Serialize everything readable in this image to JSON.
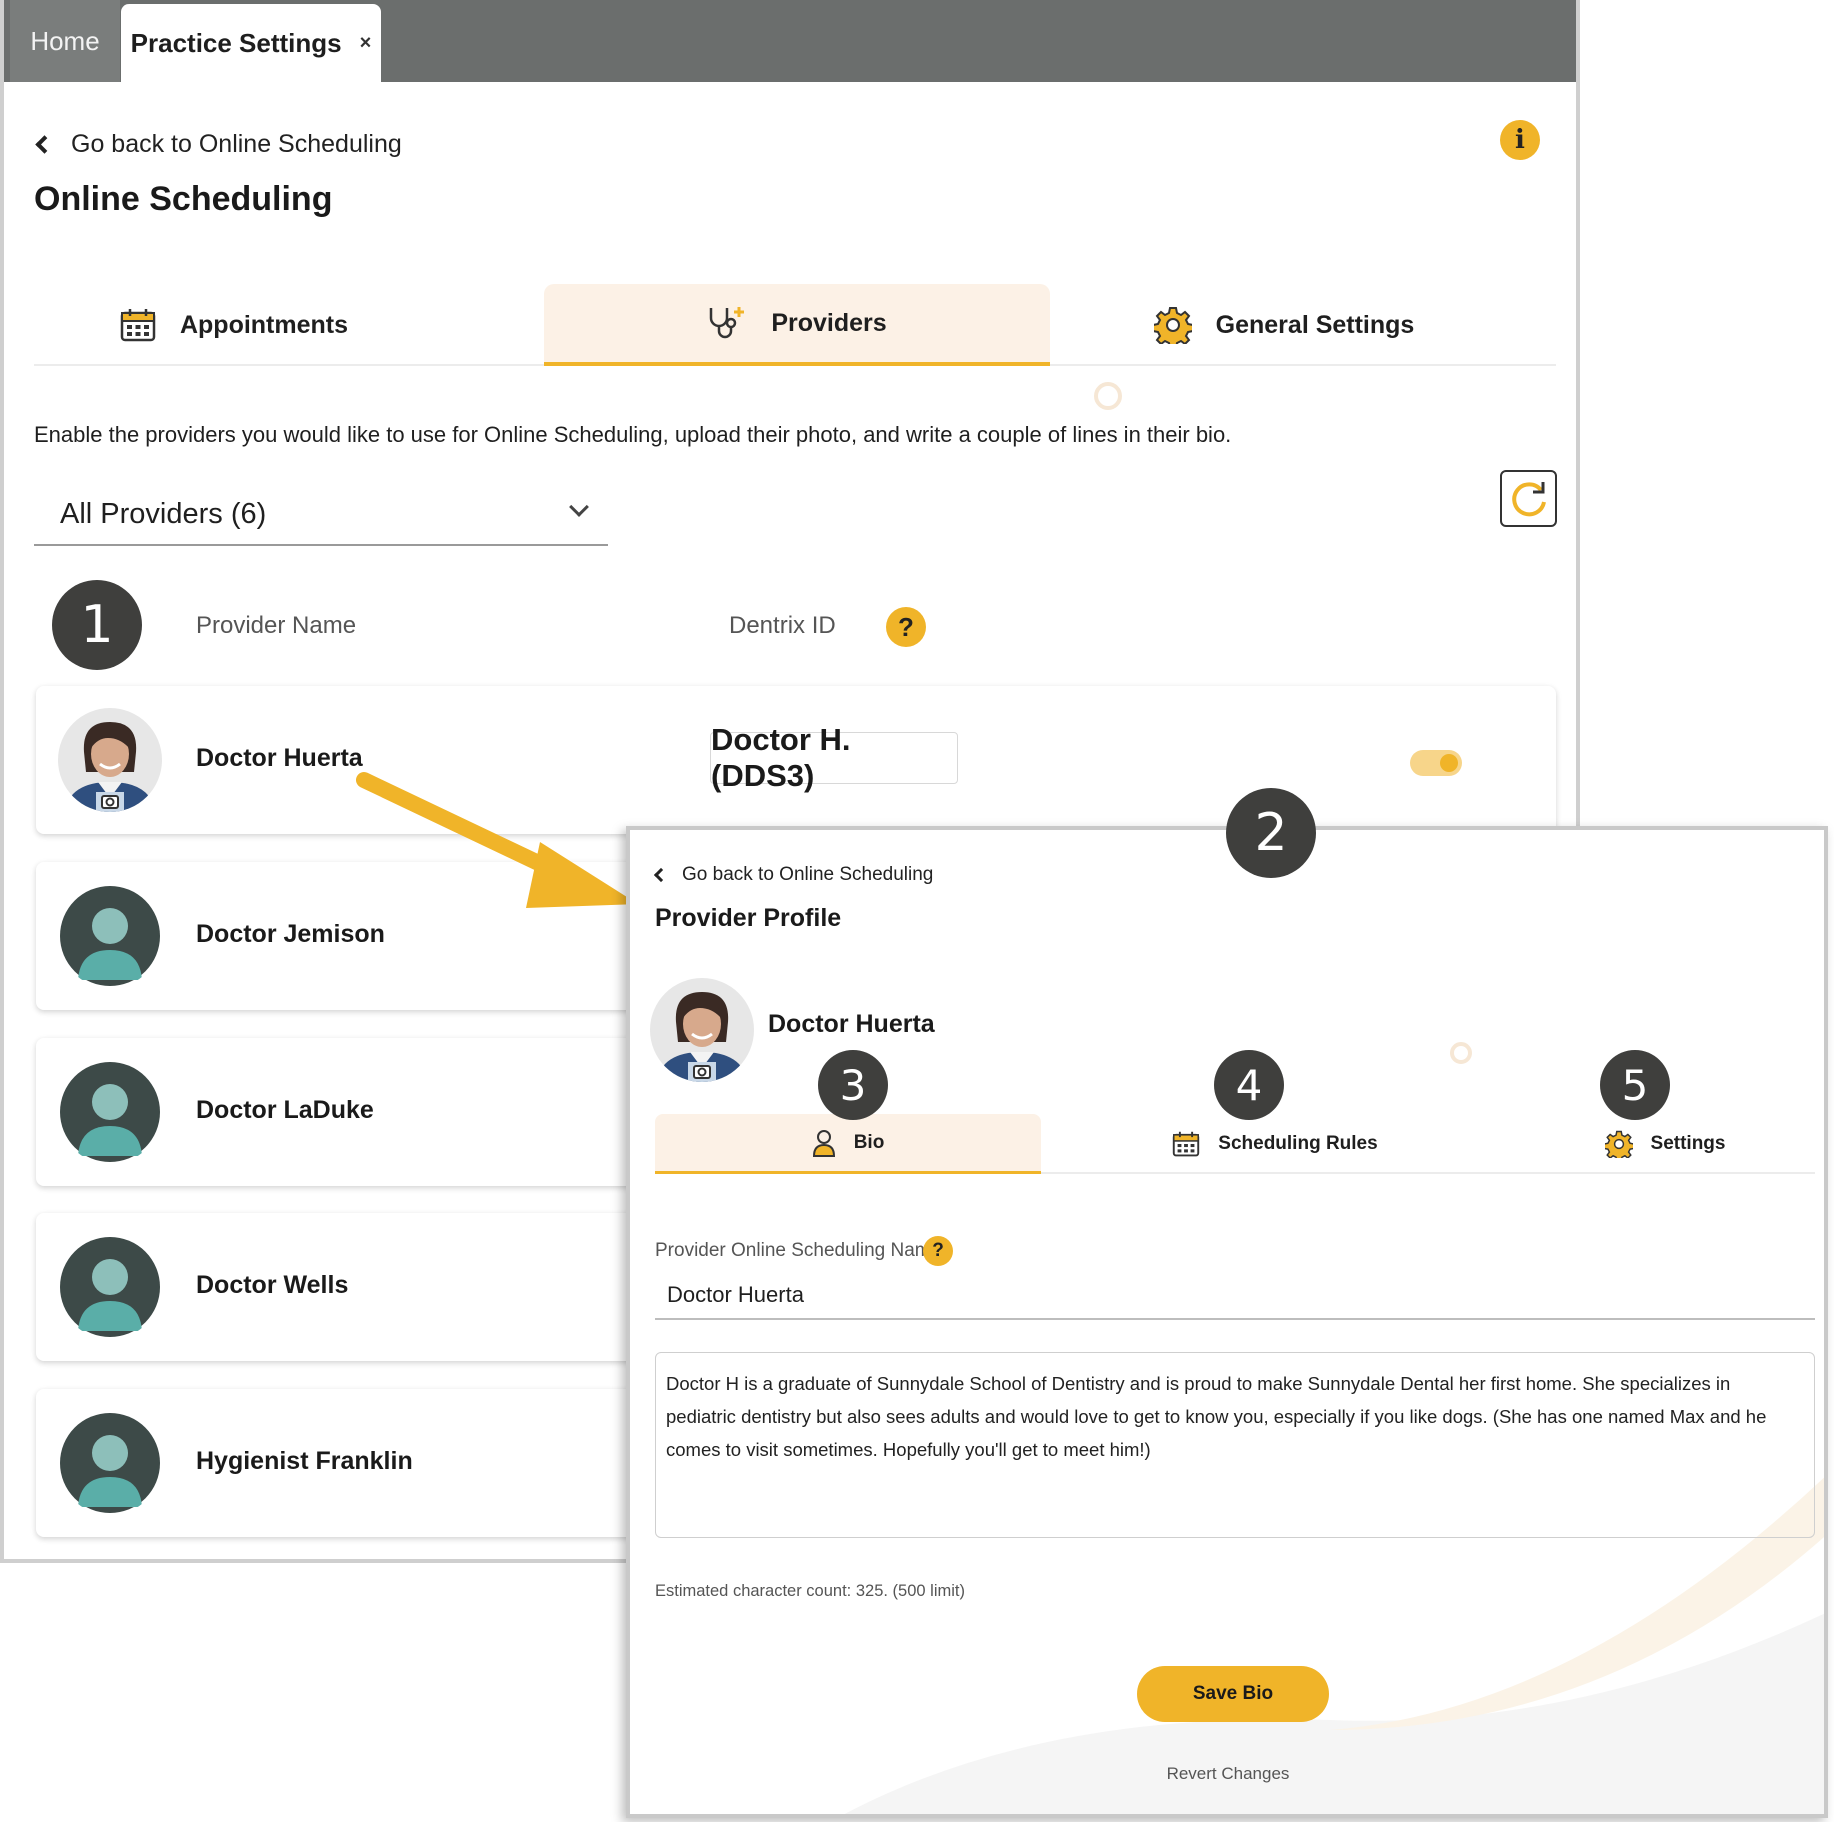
{
  "colors": {
    "accent": "#f0b429",
    "tab_bar": "#6b6e6d",
    "active_tab_bg": "#fcf1e6",
    "badge": "#3f3f3d",
    "placeholder_avatar_bg": "#3d4a48",
    "placeholder_avatar_fg": "#5aaea8"
  },
  "browser_tabs": [
    {
      "label": "Home",
      "active": false
    },
    {
      "label": "Practice Settings",
      "active": true,
      "close_icon": "×"
    }
  ],
  "main": {
    "back_link": "Go back to Online Scheduling",
    "title": "Online Scheduling",
    "info_icon": "i",
    "tabs": [
      {
        "label": "Appointments",
        "icon": "calendar-icon",
        "active": false
      },
      {
        "label": "Providers",
        "icon": "stethoscope-icon",
        "active": true
      },
      {
        "label": "General Settings",
        "icon": "gear-icon",
        "active": false
      }
    ],
    "description": "Enable the providers you would like to use for Online Scheduling, upload their photo, and write a couple of lines in their bio.",
    "filter": {
      "selected": "All Providers (6)"
    },
    "refresh_icon": "refresh-icon",
    "columns": {
      "name": "Provider Name",
      "dentrix": "Dentrix ID",
      "help": "?"
    },
    "providers": [
      {
        "name": "Doctor Huerta",
        "dentrix_id": "Doctor H. (DDS3)",
        "photo": true,
        "enabled": true
      },
      {
        "name": "Doctor Jemison",
        "photo": false
      },
      {
        "name": "Doctor LaDuke",
        "photo": false
      },
      {
        "name": "Doctor Wells",
        "photo": false
      },
      {
        "name": "Hygienist Franklin",
        "photo": false
      }
    ]
  },
  "steps": [
    "1",
    "2",
    "3",
    "4",
    "5"
  ],
  "profile": {
    "back_link": "Go back to Online Scheduling",
    "title": "Provider Profile",
    "name": "Doctor Huerta",
    "tabs": [
      {
        "label": "Bio",
        "icon": "person-icon",
        "active": true
      },
      {
        "label": "Scheduling Rules",
        "icon": "calendar-icon",
        "active": false
      },
      {
        "label": "Settings",
        "icon": "gear-icon",
        "active": false
      }
    ],
    "field_label": "Provider Online Scheduling Name",
    "help": "?",
    "field_value": "Doctor Huerta",
    "bio": "Doctor H is a graduate of Sunnydale School of Dentistry and is proud to make Sunnydale Dental her first home.  She specializes in pediatric dentistry but also sees adults and would love to get to know you, especially if you like dogs. (She has one named Max and he comes to visit sometimes. Hopefully you'll get to meet him!)",
    "char_count": "Estimated character count: 325. (500 limit)",
    "save_label": "Save Bio",
    "revert_label": "Revert Changes"
  }
}
